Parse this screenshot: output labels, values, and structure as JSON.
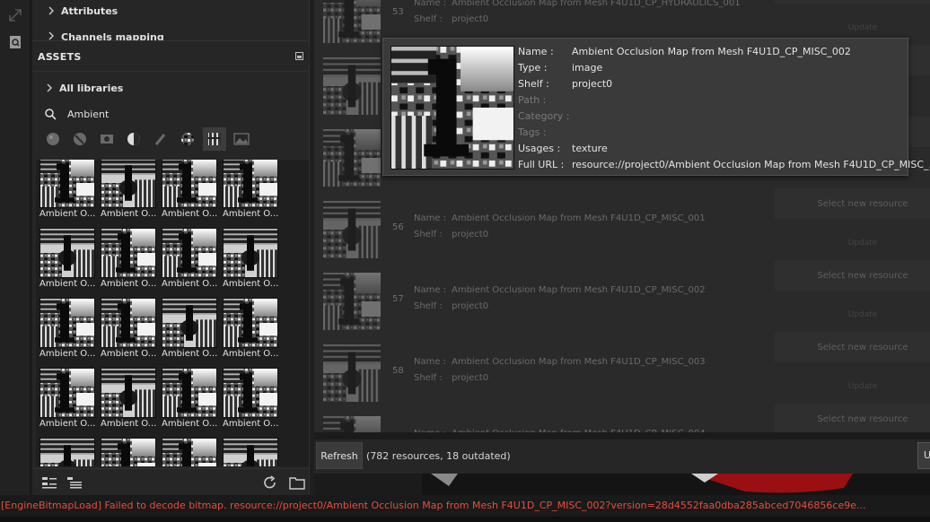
{
  "sections": [
    {
      "label": "Attributes"
    },
    {
      "label": "Channels mapping"
    }
  ],
  "assets": {
    "title": "ASSETS",
    "library": "All libraries",
    "search_value": "Ambient",
    "filters": [
      "materials",
      "smart-materials",
      "masks",
      "generators",
      "brushes",
      "alphas",
      "textures",
      "environments"
    ],
    "active_filter": "textures",
    "tile_label": "Ambient O...",
    "tile_count": 20
  },
  "list": {
    "rows": [
      {
        "num": "53",
        "name_key": "Name :",
        "name": "Ambient Occlusion Map from Mesh F4U1D_CP_HYDRAULICS_001",
        "shelf_key": "Shelf :",
        "shelf": "project0",
        "button": "Select new resource",
        "update": "Update"
      },
      {
        "num": "54",
        "name_key": "Name :",
        "name": "",
        "shelf_key": "Shelf :",
        "shelf": "",
        "button": "",
        "update": ""
      },
      {
        "num": "55",
        "name_key": "Name :",
        "name": "",
        "shelf_key": "Shelf :",
        "shelf": "",
        "button": "",
        "update": ""
      },
      {
        "num": "56",
        "name_key": "Name :",
        "name": "Ambient Occlusion Map from Mesh F4U1D_CP_MISC_001",
        "shelf_key": "Shelf :",
        "shelf": "project0",
        "button": "Select new resource",
        "update": "Update"
      },
      {
        "num": "57",
        "name_key": "Name :",
        "name": "Ambient Occlusion Map from Mesh F4U1D_CP_MISC_002",
        "shelf_key": "Shelf :",
        "shelf": "project0",
        "button": "Select new resource",
        "update": "Update"
      },
      {
        "num": "58",
        "name_key": "Name :",
        "name": "Ambient Occlusion Map from Mesh F4U1D_CP_MISC_003",
        "shelf_key": "Shelf :",
        "shelf": "project0",
        "button": "Select new resource",
        "update": "Update"
      },
      {
        "num": "",
        "name_key": "Name :",
        "name": "Ambient Occlusion Map from Mesh F4U1D_CP_MISC_004",
        "shelf_key": "",
        "shelf": "",
        "button": "Select new resource",
        "update": ""
      }
    ]
  },
  "tooltip": {
    "name_key": "Name :",
    "name": "Ambient Occlusion Map from Mesh F4U1D_CP_MISC_002",
    "type_key": "Type :",
    "type": "image",
    "shelf_key": "Shelf :",
    "shelf": "project0",
    "path_key": "Path :",
    "path": "",
    "category_key": "Category :",
    "category": "",
    "tags_key": "Tags :",
    "tags": "",
    "usages_key": "Usages :",
    "usages": "texture",
    "url_key": "Full URL :",
    "url": "resource://project0/Ambient Occlusion Map from Mesh F4U1D_CP_MISC_..."
  },
  "bottom": {
    "refresh": "Refresh",
    "count": "(782 resources, 18 outdated)",
    "right_button": "U"
  },
  "status": {
    "error": "[EngineBitmapLoad] Failed to decode bitmap. resource://project0/Ambient Occlusion Map from Mesh F4U1D_CP_MISC_002?version=28d4552faa0dba285abced7046856ce9e..."
  },
  "colors": {
    "error": "#e84c3d",
    "panel": "#262626",
    "tooltip": "#3a3a3a"
  }
}
